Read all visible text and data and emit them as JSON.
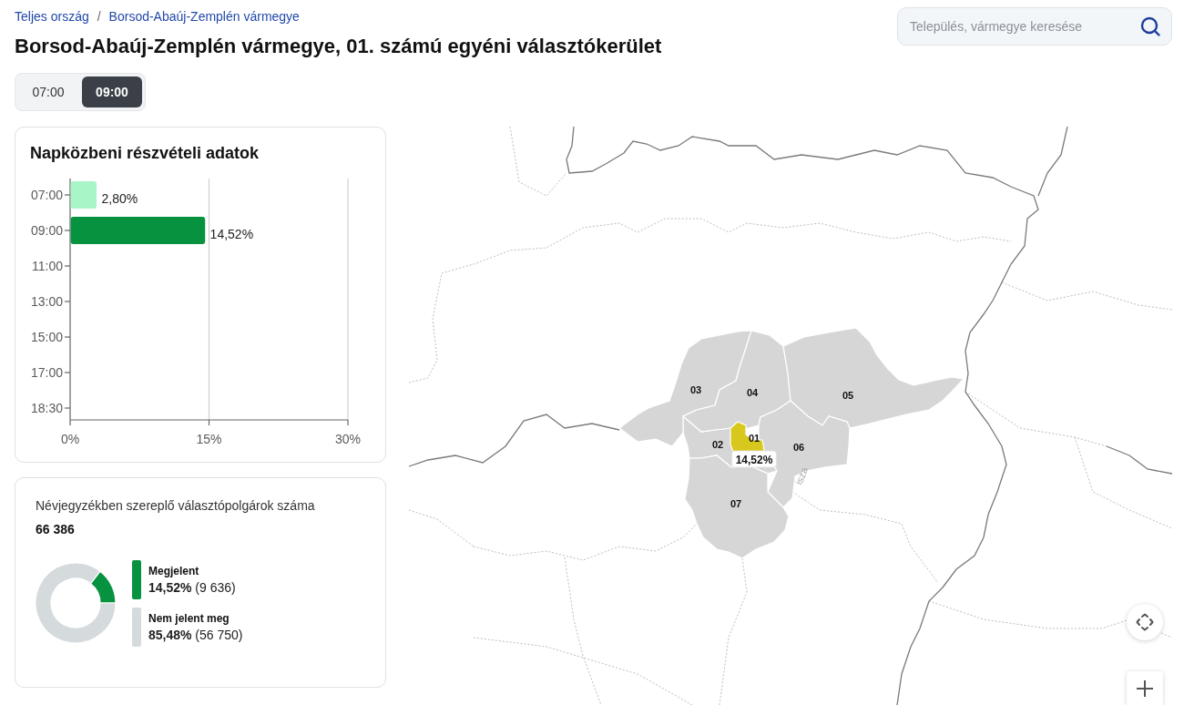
{
  "breadcrumb": {
    "items": [
      "Teljes ország",
      "Borsod-Abaúj-Zemplén vármegye"
    ],
    "separator": "/"
  },
  "title": "Borsod-Abaúj-Zemplén vármegye, 01. számú egyéni választókerület",
  "search": {
    "placeholder": "Település, vármegye keresése"
  },
  "time_tabs": [
    {
      "label": "07:00",
      "selected": false
    },
    {
      "label": "09:00",
      "selected": true
    }
  ],
  "turnout_chart": {
    "title": "Napközbeni részvételi adatok",
    "chart_data": {
      "type": "bar",
      "orientation": "horizontal",
      "categories": [
        "07:00",
        "09:00",
        "11:00",
        "13:00",
        "15:00",
        "17:00",
        "18:30"
      ],
      "values": [
        2.8,
        14.52,
        null,
        null,
        null,
        null,
        null
      ],
      "value_labels": [
        "2,80%",
        "14,52%",
        null,
        null,
        null,
        null,
        null
      ],
      "xlim": [
        0,
        30
      ],
      "xticks": [
        {
          "value": 0,
          "label": "0%"
        },
        {
          "value": 15,
          "label": "15%"
        },
        {
          "value": 30,
          "label": "30%"
        }
      ]
    }
  },
  "voters": {
    "label": "Névjegyzékben szereplő választópolgárok száma",
    "total": "66 386",
    "chart_data": {
      "type": "donut",
      "categories": [
        "Megjelent",
        "Nem jelent meg"
      ],
      "values": [
        14.52,
        85.48
      ]
    },
    "legend": [
      {
        "share": "14,52%",
        "count": "(9 636)",
        "color": "#07923f"
      },
      {
        "share": "85,48%",
        "count": "(56 750)",
        "color": "#d5dadd"
      }
    ]
  },
  "map": {
    "districts": [
      {
        "label": "01",
        "selected": true,
        "reading": "14,52%"
      },
      {
        "label": "02",
        "selected": false
      },
      {
        "label": "03",
        "selected": false
      },
      {
        "label": "04",
        "selected": false
      },
      {
        "label": "05",
        "selected": false
      },
      {
        "label": "06",
        "selected": false
      },
      {
        "label": "07",
        "selected": false
      }
    ],
    "river_label": "isza"
  }
}
